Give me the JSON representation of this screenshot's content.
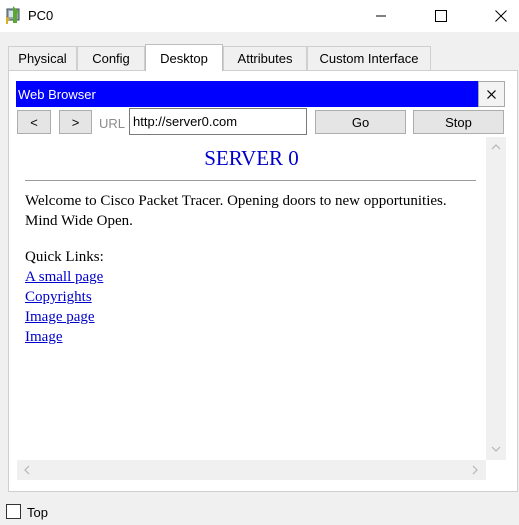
{
  "window": {
    "title": "PC0",
    "minimize_icon": "minimize-icon",
    "maximize_icon": "maximize-icon",
    "close_icon": "close-icon"
  },
  "tabs": [
    {
      "label": "Physical"
    },
    {
      "label": "Config"
    },
    {
      "label": "Desktop",
      "active": true
    },
    {
      "label": "Attributes"
    },
    {
      "label": "Custom Interface"
    }
  ],
  "browser": {
    "title": "Web Browser",
    "close_label": "×",
    "back_label": "<",
    "forward_label": ">",
    "url_label": "URL",
    "url_value": "http://server0.com",
    "go_label": "Go",
    "stop_label": "Stop"
  },
  "page": {
    "heading": "SERVER 0",
    "welcome": "Welcome to Cisco Packet Tracer. Opening doors to new opportunities. Mind Wide Open.",
    "quick_links_label": "Quick Links:",
    "links": [
      "A small page",
      "Copyrights",
      "Image page",
      "Image"
    ]
  },
  "footer": {
    "top_label": "Top",
    "top_checked": false
  },
  "colors": {
    "browser_title_bg": "#0000ff",
    "link": "#0000cc"
  }
}
